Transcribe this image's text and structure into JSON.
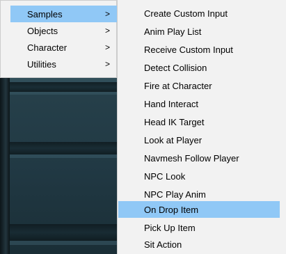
{
  "colors": {
    "menu_bg": "#f2f2f2",
    "highlight": "#90c8f6",
    "text": "#000000",
    "scene_dark": "#1a2e36"
  },
  "main_menu": {
    "items": [
      {
        "label": "Samples",
        "arrow": ">",
        "active": true
      },
      {
        "label": "Objects",
        "arrow": ">",
        "active": false
      },
      {
        "label": "Character",
        "arrow": ">",
        "active": false
      },
      {
        "label": "Utilities",
        "arrow": ">",
        "active": false
      }
    ]
  },
  "submenu": {
    "items": [
      {
        "label": "Create Custom Input"
      },
      {
        "label": "Anim Play List"
      },
      {
        "label": "Receive Custom Input"
      },
      {
        "label": "Detect Collision"
      },
      {
        "label": "Fire at Character"
      },
      {
        "label": "Hand Interact"
      },
      {
        "label": "Head IK Target"
      },
      {
        "label": "Look at Player"
      },
      {
        "label": "Navmesh Follow Player"
      },
      {
        "label": "NPC Look"
      },
      {
        "label": "NPC Play Anim"
      },
      {
        "label": "On Drop Item",
        "active": true
      },
      {
        "label": "Pick Up Item"
      },
      {
        "label": "Sit Action"
      }
    ]
  }
}
